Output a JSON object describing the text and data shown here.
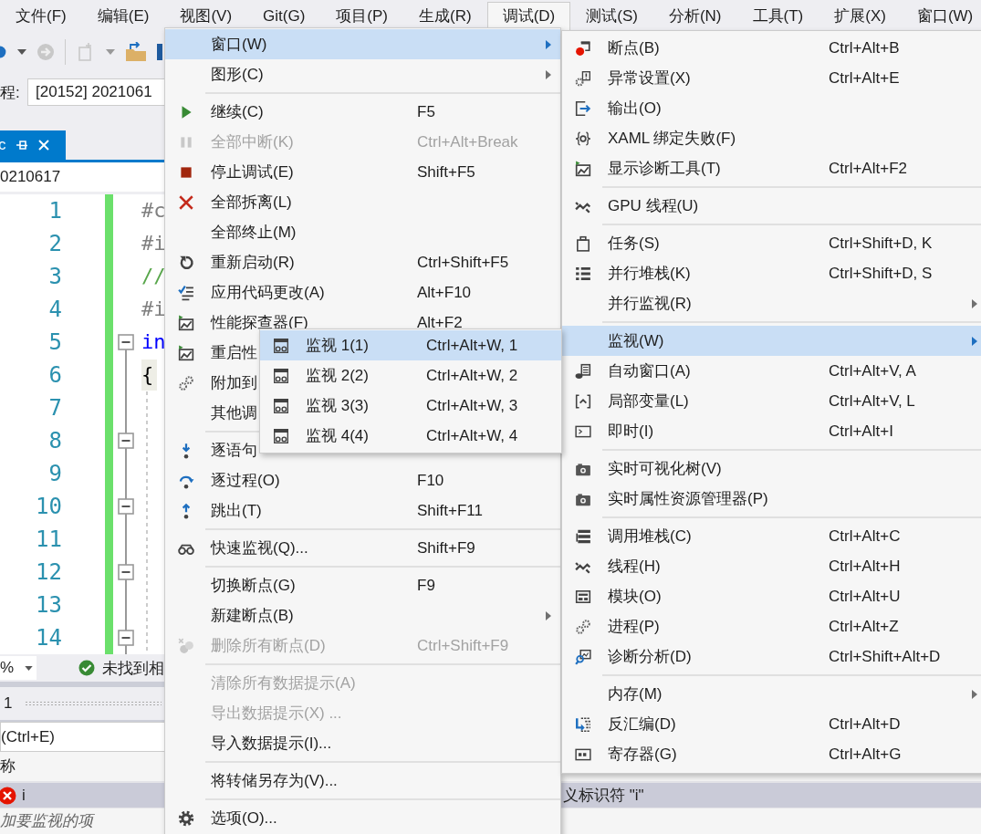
{
  "menu_bar": [
    {
      "label": "文件(F)",
      "selected": false
    },
    {
      "label": "编辑(E)",
      "selected": false
    },
    {
      "label": "视图(V)",
      "selected": false
    },
    {
      "label": "Git(G)",
      "selected": false
    },
    {
      "label": "项目(P)",
      "selected": false
    },
    {
      "label": "生成(R)",
      "selected": false
    },
    {
      "label": "调试(D)",
      "selected": true
    },
    {
      "label": "测试(S)",
      "selected": false
    },
    {
      "label": "分析(N)",
      "selected": false
    },
    {
      "label": "工具(T)",
      "selected": false
    },
    {
      "label": "扩展(X)",
      "selected": false
    },
    {
      "label": "窗口(W)",
      "selected": false
    }
  ],
  "process": {
    "label": "程:",
    "value": "[20152] 2021061"
  },
  "document_tab": {
    "label": "c"
  },
  "path_bar": {
    "text": "0210617"
  },
  "editor": {
    "lines": [
      {
        "number": "1",
        "code": "#c",
        "kind": "directive",
        "fold": false,
        "highlighted": false
      },
      {
        "number": "2",
        "code": "#i",
        "kind": "directive",
        "fold": false,
        "highlighted": false
      },
      {
        "number": "3",
        "code": "//",
        "kind": "comment",
        "fold": false,
        "highlighted": false
      },
      {
        "number": "4",
        "code": "#i",
        "kind": "directive",
        "fold": false,
        "highlighted": false
      },
      {
        "number": "5",
        "code": "in",
        "kind": "keyword",
        "fold": true,
        "highlighted": false
      },
      {
        "number": "6",
        "code": "{",
        "kind": "plain",
        "fold": false,
        "highlighted": true
      },
      {
        "number": "7",
        "fold": false
      },
      {
        "number": "8",
        "fold": true
      },
      {
        "number": "9",
        "fold": false
      },
      {
        "number": "10",
        "fold": true
      },
      {
        "number": "11",
        "fold": false
      },
      {
        "number": "12",
        "fold": true
      },
      {
        "number": "13",
        "fold": false
      },
      {
        "number": "14",
        "fold": true
      }
    ]
  },
  "status_bar": {
    "zoom": "%",
    "message": "未找到相"
  },
  "watch_panel": {
    "tab": "1",
    "search": {
      "placeholder": "(Ctrl+E)"
    },
    "column": "称",
    "rows": [
      {
        "name": "i",
        "value": "义标识符 \"i\"",
        "error": true,
        "selected": true
      }
    ],
    "add_hint": "加要监视的项"
  },
  "debug_menu": {
    "sections": [
      [
        {
          "label": "窗口(W)",
          "selected": true,
          "disabled": false,
          "submenu": true
        },
        {
          "label": "图形(C)",
          "selected": false,
          "disabled": false,
          "submenu": true
        }
      ],
      [
        {
          "label": "继续(C)",
          "shortcut": "F5",
          "selected": false,
          "disabled": false,
          "submenu": false
        },
        {
          "label": "全部中断(K)",
          "shortcut": "Ctrl+Alt+Break",
          "selected": false,
          "disabled": true,
          "submenu": false
        },
        {
          "label": "停止调试(E)",
          "shortcut": "Shift+F5",
          "selected": false,
          "disabled": false,
          "submenu": false
        },
        {
          "label": "全部拆离(L)",
          "selected": false,
          "disabled": false,
          "submenu": false
        },
        {
          "label": "全部终止(M)",
          "selected": false,
          "disabled": false,
          "submenu": false
        },
        {
          "label": "重新启动(R)",
          "shortcut": "Ctrl+Shift+F5",
          "selected": false,
          "disabled": false,
          "submenu": false
        },
        {
          "label": "应用代码更改(A)",
          "shortcut": "Alt+F10",
          "selected": false,
          "disabled": false,
          "submenu": false
        },
        {
          "label": "性能探查器(F)",
          "shortcut": "Alt+F2",
          "selected": false,
          "disabled": false,
          "submenu": false
        },
        {
          "label": "重启性",
          "selected": false,
          "disabled": false,
          "submenu": false
        },
        {
          "label": "附加到",
          "selected": false,
          "disabled": false,
          "submenu": false
        },
        {
          "label": "其他调",
          "selected": false,
          "disabled": false,
          "submenu": false
        }
      ],
      [
        {
          "label": "逐语句",
          "selected": false,
          "disabled": false,
          "submenu": false
        },
        {
          "label": "逐过程(O)",
          "shortcut": "F10",
          "selected": false,
          "disabled": false,
          "submenu": false
        },
        {
          "label": "跳出(T)",
          "shortcut": "Shift+F11",
          "selected": false,
          "disabled": false,
          "submenu": false
        }
      ],
      [
        {
          "label": "快速监视(Q)...",
          "shortcut": "Shift+F9",
          "selected": false,
          "disabled": false,
          "submenu": false
        }
      ],
      [
        {
          "label": "切换断点(G)",
          "shortcut": "F9",
          "selected": false,
          "disabled": false,
          "submenu": false
        },
        {
          "label": "新建断点(B)",
          "selected": false,
          "disabled": false,
          "submenu": true
        },
        {
          "label": "删除所有断点(D)",
          "shortcut": "Ctrl+Shift+F9",
          "selected": false,
          "disabled": true,
          "submenu": false
        }
      ],
      [
        {
          "label": "清除所有数据提示(A)",
          "selected": false,
          "disabled": true,
          "submenu": false
        },
        {
          "label": "导出数据提示(X) ...",
          "selected": false,
          "disabled": true,
          "submenu": false
        },
        {
          "label": "导入数据提示(I)...",
          "selected": false,
          "disabled": false,
          "submenu": false
        }
      ],
      [
        {
          "label": "将转储另存为(V)...",
          "selected": false,
          "disabled": false,
          "submenu": false
        }
      ],
      [
        {
          "label": "选项(O)...",
          "selected": false,
          "disabled": false,
          "submenu": false
        }
      ]
    ]
  },
  "window_submenu": {
    "sections": [
      [
        {
          "label": "断点(B)",
          "shortcut": "Ctrl+Alt+B",
          "selected": false,
          "submenu": false
        },
        {
          "label": "异常设置(X)",
          "shortcut": "Ctrl+Alt+E",
          "selected": false,
          "submenu": false
        },
        {
          "label": "输出(O)",
          "selected": false,
          "submenu": false
        },
        {
          "label": "XAML 绑定失败(F)",
          "selected": false,
          "submenu": false
        },
        {
          "label": "显示诊断工具(T)",
          "shortcut": "Ctrl+Alt+F2",
          "selected": false,
          "submenu": false
        }
      ],
      [
        {
          "label": "GPU 线程(U)",
          "selected": false,
          "submenu": false
        }
      ],
      [
        {
          "label": "任务(S)",
          "shortcut": "Ctrl+Shift+D, K",
          "selected": false,
          "submenu": false
        },
        {
          "label": "并行堆栈(K)",
          "shortcut": "Ctrl+Shift+D, S",
          "selected": false,
          "submenu": false
        },
        {
          "label": "并行监视(R)",
          "selected": false,
          "submenu": true
        }
      ],
      [
        {
          "label": "监视(W)",
          "selected": true,
          "submenu": true
        },
        {
          "label": "自动窗口(A)",
          "shortcut": "Ctrl+Alt+V, A",
          "selected": false,
          "submenu": false
        },
        {
          "label": "局部变量(L)",
          "shortcut": "Ctrl+Alt+V, L",
          "selected": false,
          "submenu": false
        },
        {
          "label": "即时(I)",
          "shortcut": "Ctrl+Alt+I",
          "selected": false,
          "submenu": false
        }
      ],
      [
        {
          "label": "实时可视化树(V)",
          "selected": false,
          "submenu": false
        },
        {
          "label": "实时属性资源管理器(P)",
          "selected": false,
          "submenu": false
        }
      ],
      [
        {
          "label": "调用堆栈(C)",
          "shortcut": "Ctrl+Alt+C",
          "selected": false,
          "submenu": false
        },
        {
          "label": "线程(H)",
          "shortcut": "Ctrl+Alt+H",
          "selected": false,
          "submenu": false
        },
        {
          "label": "模块(O)",
          "shortcut": "Ctrl+Alt+U",
          "selected": false,
          "submenu": false
        },
        {
          "label": "进程(P)",
          "shortcut": "Ctrl+Alt+Z",
          "selected": false,
          "submenu": false
        },
        {
          "label": "诊断分析(D)",
          "shortcut": "Ctrl+Shift+Alt+D",
          "selected": false,
          "submenu": false
        }
      ],
      [
        {
          "label": "内存(M)",
          "selected": false,
          "submenu": true
        },
        {
          "label": "反汇编(D)",
          "shortcut": "Ctrl+Alt+D",
          "selected": false,
          "submenu": false
        },
        {
          "label": "寄存器(G)",
          "shortcut": "Ctrl+Alt+G",
          "selected": false,
          "submenu": false
        }
      ]
    ]
  },
  "watch_submenu": {
    "items": [
      {
        "label": "监视 1(1)",
        "shortcut": "Ctrl+Alt+W, 1",
        "selected": true
      },
      {
        "label": "监视 2(2)",
        "shortcut": "Ctrl+Alt+W, 2",
        "selected": false
      },
      {
        "label": "监视 3(3)",
        "shortcut": "Ctrl+Alt+W, 3",
        "selected": false
      },
      {
        "label": "监视 4(4)",
        "shortcut": "Ctrl+Alt+W, 4",
        "selected": false
      }
    ]
  }
}
